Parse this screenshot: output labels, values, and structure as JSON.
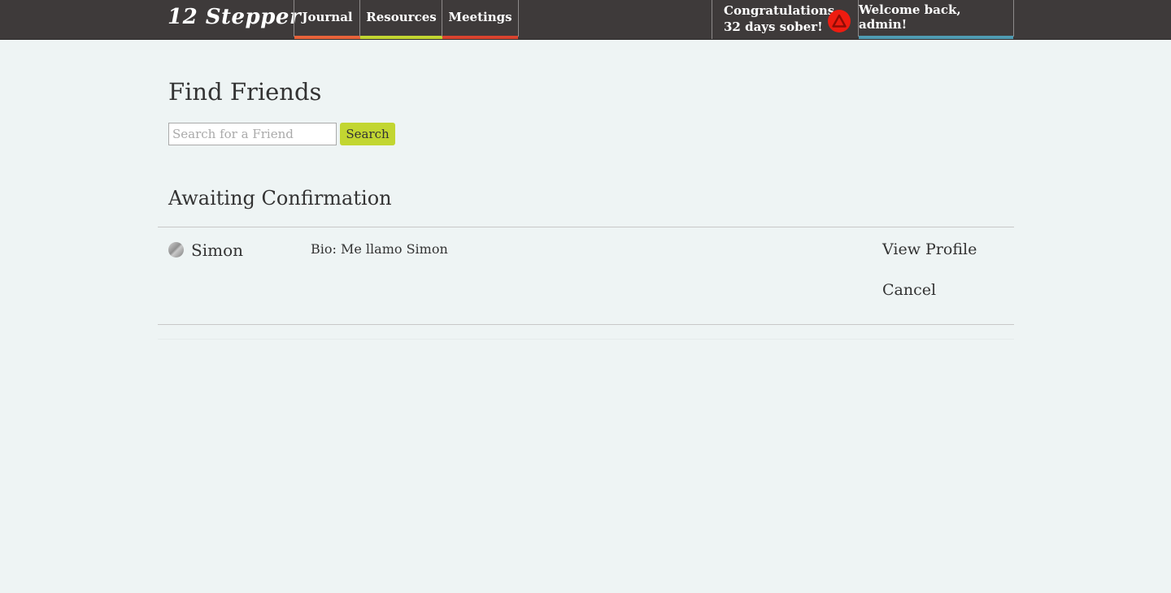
{
  "header": {
    "logo": "12 Stepper",
    "nav": [
      {
        "label": "Journal",
        "color": "#e8633a"
      },
      {
        "label": "Resources",
        "color": "#c2d631"
      },
      {
        "label": "Meetings",
        "color": "#d9432f"
      }
    ],
    "congrats_line1": "Congratulations,",
    "congrats_line2": "32 days sober!",
    "badge_icon": "warning-triangle-icon",
    "badge_color": "#ee1c10",
    "welcome": "Welcome back, admin!",
    "welcome_color": "#4f9cb3"
  },
  "find_friends": {
    "title": "Find Friends",
    "search_placeholder": "Search for a Friend",
    "search_value": "",
    "search_button": "Search",
    "accent": "#c2d631"
  },
  "awaiting": {
    "title": "Awaiting Confirmation",
    "friends": [
      {
        "name": "Simon",
        "bio": "Bio: Me llamo Simon",
        "view_profile": "View Profile",
        "cancel": "Cancel"
      }
    ]
  }
}
